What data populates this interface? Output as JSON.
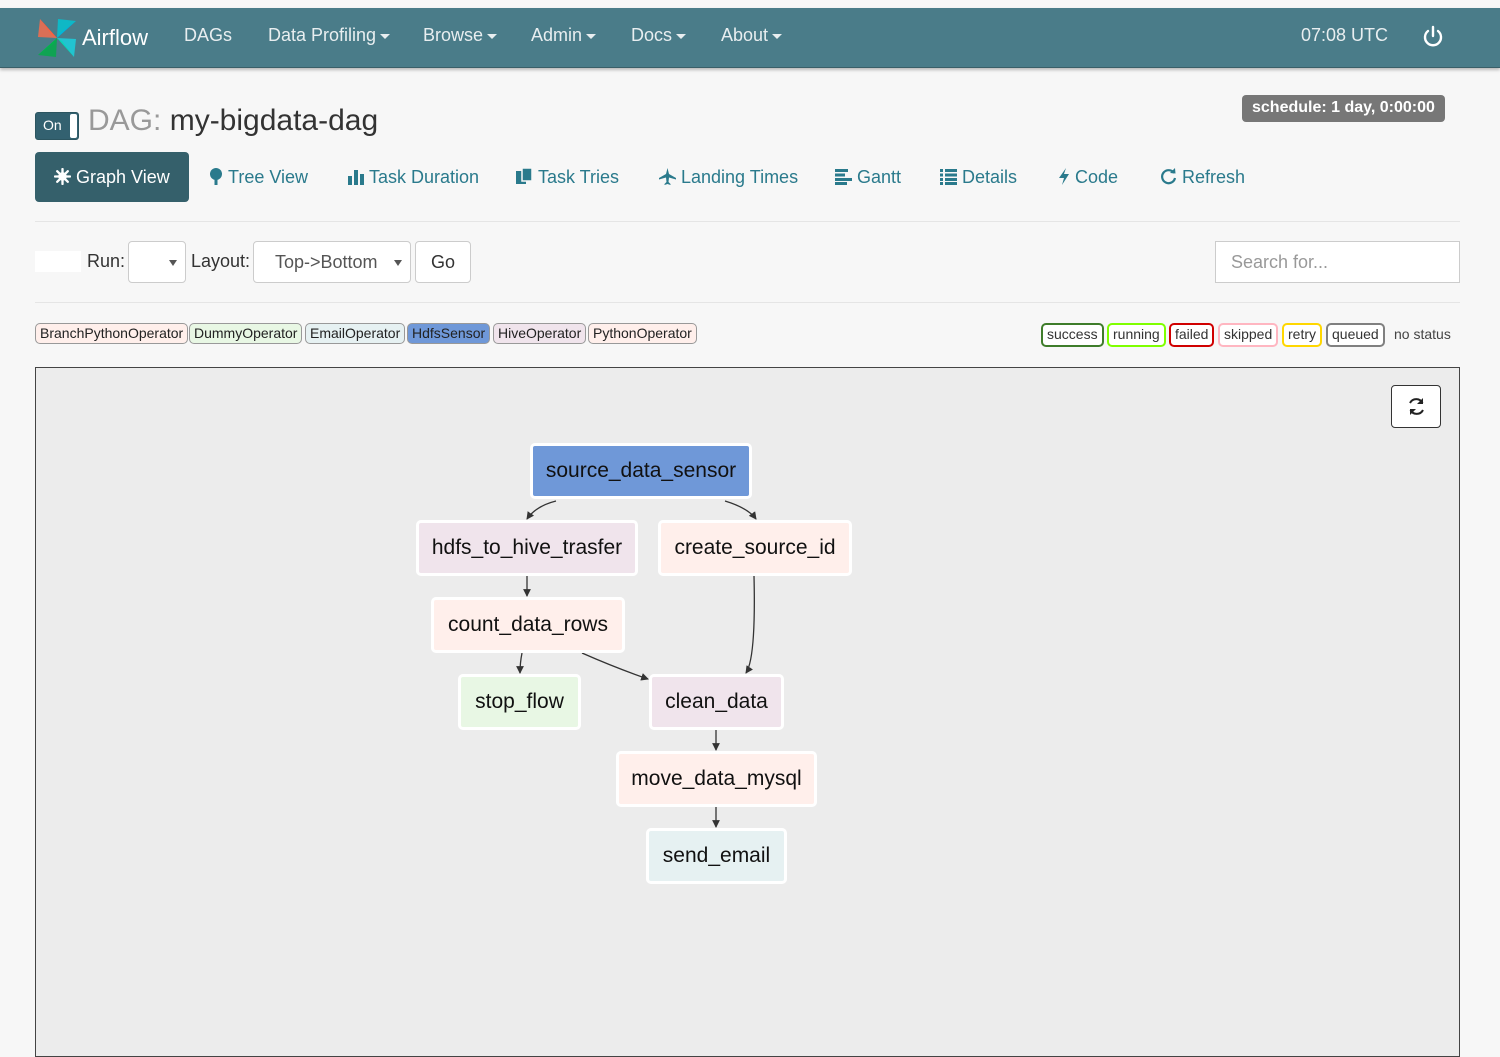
{
  "navbar": {
    "brand": "Airflow",
    "items": [
      {
        "label": "DAGs",
        "dropdown": false
      },
      {
        "label": "Data Profiling",
        "dropdown": true
      },
      {
        "label": "Browse",
        "dropdown": true
      },
      {
        "label": "Admin",
        "dropdown": true
      },
      {
        "label": "Docs",
        "dropdown": true
      },
      {
        "label": "About",
        "dropdown": true
      }
    ],
    "clock": "07:08 UTC",
    "power_icon": "power-icon",
    "bg_color": "#4a7c89"
  },
  "dag": {
    "toggle_label": "On",
    "prefix": "DAG:",
    "name": "my-bigdata-dag",
    "schedule": "schedule: 1 day, 0:00:00"
  },
  "tabs": [
    {
      "label": "Graph View",
      "icon": "asterisk-icon",
      "active": true
    },
    {
      "label": "Tree View",
      "icon": "tree-icon",
      "active": false
    },
    {
      "label": "Task Duration",
      "icon": "bar-chart-icon",
      "active": false
    },
    {
      "label": "Task Tries",
      "icon": "duplicate-icon",
      "active": false
    },
    {
      "label": "Landing Times",
      "icon": "plane-icon",
      "active": false
    },
    {
      "label": "Gantt",
      "icon": "align-left-icon",
      "active": false
    },
    {
      "label": "Details",
      "icon": "list-icon",
      "active": false
    },
    {
      "label": "Code",
      "icon": "flash-icon",
      "active": false
    },
    {
      "label": "Refresh",
      "icon": "refresh-icon",
      "active": false
    }
  ],
  "controls": {
    "run_label": "Run:",
    "run_value": "",
    "layout_label": "Layout:",
    "layout_value": "Top->Bottom",
    "go_label": "Go",
    "search_placeholder": "Search for..."
  },
  "operators": [
    {
      "label": "BranchPythonOperator",
      "color": "#ffefeb"
    },
    {
      "label": "DummyOperator",
      "color": "#e8f7e4"
    },
    {
      "label": "EmailOperator",
      "color": "#e6f1f2"
    },
    {
      "label": "HdfsSensor",
      "color": "#6f98d8"
    },
    {
      "label": "HiveOperator",
      "color": "#f0e4ec"
    },
    {
      "label": "PythonOperator",
      "color": "#ffefeb"
    }
  ],
  "statuses": [
    {
      "label": "success",
      "color": "#3f7d2b"
    },
    {
      "label": "running",
      "color": "#7fff00"
    },
    {
      "label": "failed",
      "color": "#d00000"
    },
    {
      "label": "skipped",
      "color": "#ffb6c1"
    },
    {
      "label": "retry",
      "color": "#ffd700"
    },
    {
      "label": "queued",
      "color": "#808080"
    }
  ],
  "no_status": "no status",
  "graph": {
    "refresh_icon": "refresh-icon",
    "nodes": [
      {
        "id": "source_data_sensor",
        "label": "source_data_sensor",
        "color": "#6f98d8"
      },
      {
        "id": "hdfs_to_hive_trasfer",
        "label": "hdfs_to_hive_trasfer",
        "color": "#f0e4ec"
      },
      {
        "id": "create_source_id",
        "label": "create_source_id",
        "color": "#ffefeb"
      },
      {
        "id": "count_data_rows",
        "label": "count_data_rows",
        "color": "#ffefeb"
      },
      {
        "id": "stop_flow",
        "label": "stop_flow",
        "color": "#e8f7e4"
      },
      {
        "id": "clean_data",
        "label": "clean_data",
        "color": "#f0e4ec"
      },
      {
        "id": "move_data_mysql",
        "label": "move_data_mysql",
        "color": "#ffefeb"
      },
      {
        "id": "send_email",
        "label": "send_email",
        "color": "#e6f1f2"
      }
    ],
    "edges": [
      [
        "source_data_sensor",
        "hdfs_to_hive_trasfer"
      ],
      [
        "source_data_sensor",
        "create_source_id"
      ],
      [
        "hdfs_to_hive_trasfer",
        "count_data_rows"
      ],
      [
        "count_data_rows",
        "stop_flow"
      ],
      [
        "count_data_rows",
        "clean_data"
      ],
      [
        "create_source_id",
        "clean_data"
      ],
      [
        "clean_data",
        "move_data_mysql"
      ],
      [
        "move_data_mysql",
        "send_email"
      ]
    ]
  }
}
